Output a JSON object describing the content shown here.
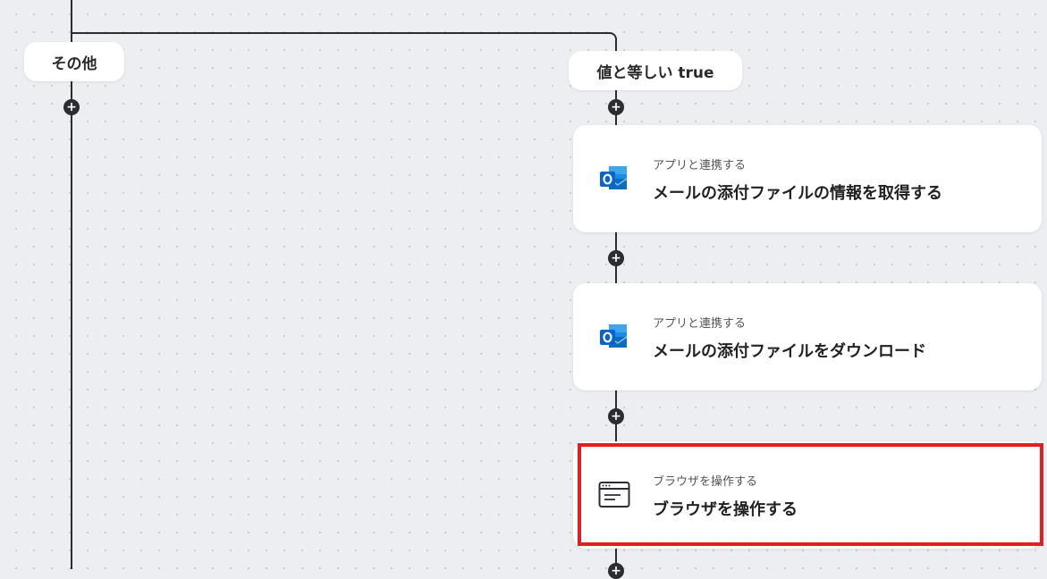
{
  "branches": {
    "left": {
      "label": "その他"
    },
    "right": {
      "label": "値と等しい true"
    }
  },
  "steps": [
    {
      "category": "アプリと連携する",
      "title": "メールの添付ファイルの情報を取得する",
      "icon": "outlook-icon"
    },
    {
      "category": "アプリと連携する",
      "title": "メールの添付ファイルをダウンロード",
      "icon": "outlook-icon"
    },
    {
      "category": "ブラウザを操作する",
      "title": "ブラウザを操作する",
      "icon": "browser-window-icon"
    }
  ],
  "add_button": {
    "glyph": "+"
  },
  "colors": {
    "background": "#eceef2",
    "wire": "#2b2d33",
    "card": "#ffffff",
    "highlight": "#e02020",
    "outlook_blue": "#0a64c8"
  }
}
